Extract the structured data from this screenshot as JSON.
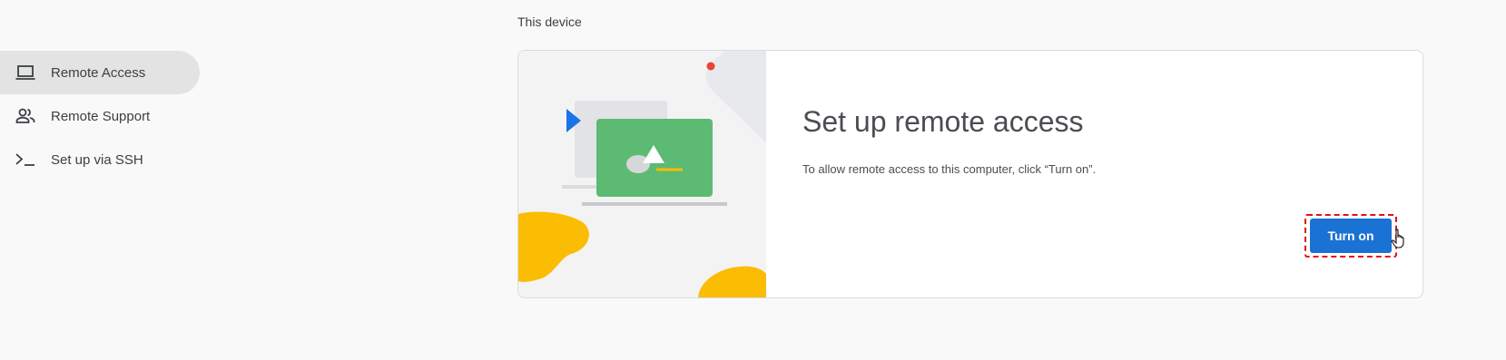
{
  "sidebar": {
    "items": [
      {
        "label": "Remote Access",
        "icon": "laptop-icon",
        "active": true
      },
      {
        "label": "Remote Support",
        "icon": "people-icon",
        "active": false
      },
      {
        "label": "Set up via SSH",
        "icon": "terminal-icon",
        "active": false
      }
    ]
  },
  "main": {
    "section_title": "This device",
    "card": {
      "title": "Set up remote access",
      "description": "To allow remote access to this computer, click “Turn on”.",
      "button_label": "Turn on"
    }
  },
  "colors": {
    "accent": "#1a73d4",
    "highlight_border": "#e0101a",
    "illustration_green": "#5dba73",
    "illustration_yellow": "#fbbc04",
    "illustration_blue": "#1a73e8",
    "illustration_red": "#ea4335"
  }
}
